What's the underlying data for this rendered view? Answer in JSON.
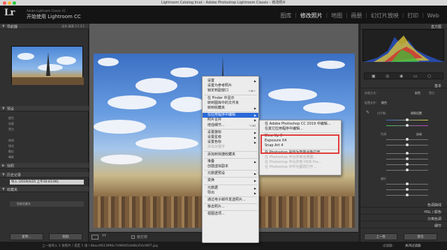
{
  "window_title": "Lightroom Catalog.lrcat - Adobe Photoshop Lightroom Classic - 修改照片",
  "header": {
    "logo": "Lr",
    "product_sub": "Adobe Lightroom Classic CC",
    "product_main": "开始使用 Lightroom CC",
    "modules": [
      "图库",
      "修改照片",
      "地图",
      "画册",
      "幻灯片放映",
      "打印",
      "Web"
    ],
    "active_module": "修改照片"
  },
  "left_panel": {
    "navigator_label": "导航器",
    "navigator_opts": "适合  填满  1:1  3:1",
    "presets_label": "预设",
    "preset_items": [
      "颜色",
      "创意",
      "黑白",
      "曲线",
      "锐化",
      "颗粒",
      "晕影"
    ],
    "snapshots_label": "快照",
    "history_label": "历史记录",
    "history_item": "导入 (2019/4/25 上午10:43:06)",
    "collections_label": "收藏夹",
    "collection_item": "智能收藏夹",
    "copy_button": "复制...",
    "paste_button": "粘贴"
  },
  "toolbar": {
    "before_after": "YY",
    "soft_proof": "软打样"
  },
  "right_panel": {
    "histogram_label": "直方图",
    "basic_label": "基本",
    "treatment_label": "处理方式：",
    "treatment_color": "彩色",
    "treatment_bw": "黑白",
    "profile_label": "配置文件：",
    "profile_value": "颜色",
    "wb_label": "白平衡：",
    "wb_value": "原照设置",
    "tone_label": "色调",
    "tone_auto": "自动",
    "presence_label": "偏好",
    "panels": [
      "色调曲线",
      "HSL / 颜色",
      "分离色调",
      "细节"
    ],
    "prev_button": "上一张",
    "reset_button": "复位"
  },
  "status_bar": {
    "text": "上一张导入  1 张照片 / 选定 1 张 / 8bacdf613996c7d96645dd8b354c96f7.jpg",
    "filter_label": "过滤器：",
    "filter_value": "关闭过滤器"
  },
  "context_menu": {
    "items": [
      {
        "label": "设置",
        "arrow": true
      },
      {
        "label": "设置为参考照片"
      },
      {
        "label": "锁定到副窗口",
        "shortcut": "⇧⌘↩"
      },
      {
        "sep": true
      },
      {
        "label": "在 Finder 中显示"
      },
      {
        "label": "转到图库中的文件夹"
      },
      {
        "label": "转到收藏夹",
        "arrow": true
      },
      {
        "sep": true
      },
      {
        "label": "在应用程序中编辑",
        "arrow": true,
        "highlight": true
      },
      {
        "label": "照片合并",
        "arrow": true
      },
      {
        "label": "增强细节...",
        "shortcut": "⌥⌘I"
      },
      {
        "sep": true
      },
      {
        "label": "设置旗标",
        "arrow": true
      },
      {
        "label": "设置星级",
        "arrow": true
      },
      {
        "label": "设置色标",
        "arrow": true
      },
      {
        "label": "添加关键字",
        "disabled": true
      },
      {
        "sep": true
      },
      {
        "label": "添加到快捷收藏夹"
      },
      {
        "sep": true
      },
      {
        "label": "堆叠",
        "arrow": true
      },
      {
        "label": "创建虚拟副本"
      },
      {
        "sep": true
      },
      {
        "label": "元数据预设",
        "arrow": true
      },
      {
        "sep": true
      },
      {
        "label": "变换",
        "arrow": true
      },
      {
        "sep": true
      },
      {
        "label": "元数据",
        "arrow": true
      },
      {
        "label": "导出",
        "arrow": true
      },
      {
        "sep": true
      },
      {
        "label": "通过电子邮件发送照片..."
      },
      {
        "sep": true
      },
      {
        "label": "移去照片..."
      },
      {
        "sep": true
      },
      {
        "label": "视图选项..."
      }
    ]
  },
  "submenu": {
    "items": [
      {
        "label": "在 Adobe Photoshop CC 2019 中编辑..."
      },
      {
        "label": "在其它应用程序中编辑..."
      },
      {
        "sep": true
      },
      {
        "label": "Blow Up 3"
      },
      {
        "label": "Exposure X4"
      },
      {
        "label": "Snap Art 4"
      },
      {
        "sep": true
      },
      {
        "label": "在 Photoshop 中作为智能对象打开..."
      },
      {
        "label": "在 Photoshop 中合并到全景图...",
        "disabled": true
      },
      {
        "label": "在 Photoshop 中合并到 HDR Pro...",
        "disabled": true
      },
      {
        "label": "在 Photoshop 中作为图层打开...",
        "disabled": true
      }
    ]
  },
  "colors": {
    "accent": "#2a69d8",
    "annotation_box": "#e23b3b"
  }
}
